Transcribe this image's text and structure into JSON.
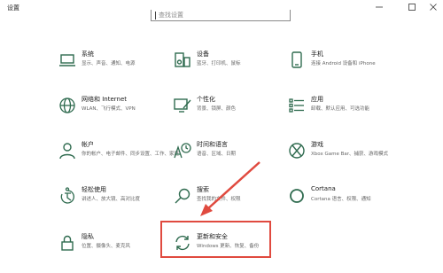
{
  "window": {
    "title": "设置"
  },
  "search": {
    "placeholder": "查找设置",
    "value": ""
  },
  "items": [
    {
      "name": "系统",
      "desc": "显示、声音、通知、电源",
      "icon": "laptop-icon"
    },
    {
      "name": "设备",
      "desc": "蓝牙、打印机、鼠标",
      "icon": "devices-icon"
    },
    {
      "name": "手机",
      "desc": "连接 Android 设备和 iPhone",
      "icon": "phone-icon"
    },
    {
      "name": "网络和 Internet",
      "desc": "WLAN、飞行模式、VPN",
      "icon": "globe-icon"
    },
    {
      "name": "个性化",
      "desc": "背景、锁屏、颜色",
      "icon": "personalization-icon"
    },
    {
      "name": "应用",
      "desc": "卸载、默认应用、可选功能",
      "icon": "apps-icon"
    },
    {
      "name": "帐户",
      "desc": "你的帐户、电子邮件、同步设置、工作、家庭",
      "icon": "person-icon"
    },
    {
      "name": "时间和语言",
      "desc": "语音、区域、日期",
      "icon": "time-language-icon"
    },
    {
      "name": "游戏",
      "desc": "Xbox Game Bar、捕获、游戏模式",
      "icon": "xbox-icon"
    },
    {
      "name": "轻松使用",
      "desc": "讲述人、放大镜、高对比度",
      "icon": "ease-of-access-icon"
    },
    {
      "name": "搜索",
      "desc": "查找我的文件、权限",
      "icon": "search-icon"
    },
    {
      "name": "Cortana",
      "desc": "Cortana 语言、权限、通知",
      "icon": "cortana-icon"
    },
    {
      "name": "隐私",
      "desc": "位置、摄像头、麦克风",
      "icon": "lock-icon"
    },
    {
      "name": "更新和安全",
      "desc": "Windows 更新、恢复、备份",
      "icon": "sync-icon"
    }
  ],
  "colors": {
    "icon": "#2f6b4f",
    "highlight": "#e04a3f",
    "text": "#1a1a1a",
    "secondary": "#666666"
  }
}
